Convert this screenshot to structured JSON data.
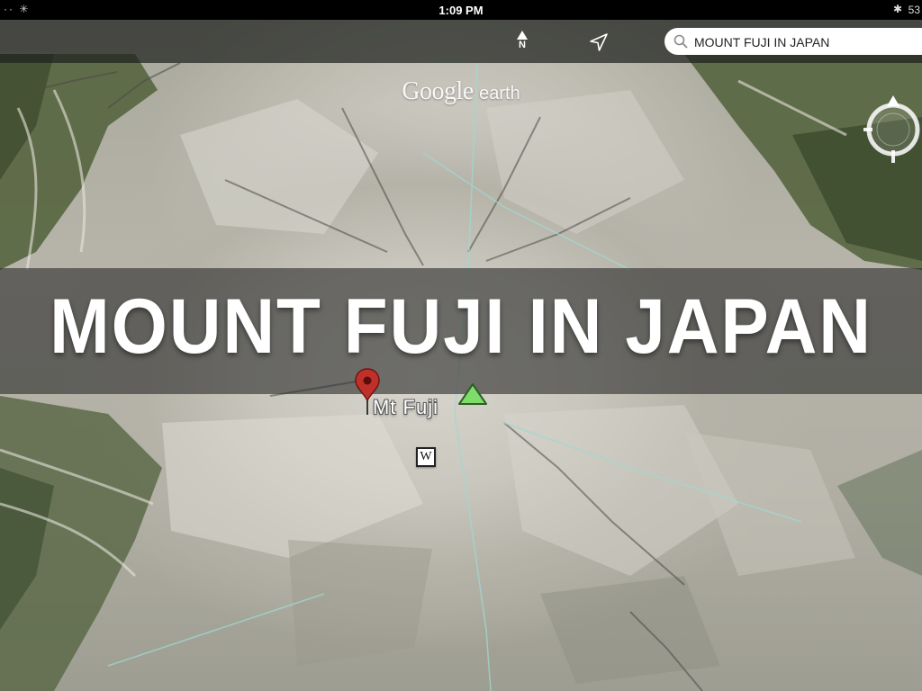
{
  "status_bar": {
    "time": "1:09 PM",
    "battery": "53",
    "left_indicator": "·· ✳",
    "bluetooth_icon": "bluetooth-icon"
  },
  "toolbar": {
    "north_label": "N",
    "search_value": "MOUNT FUJI IN JAPAN",
    "icons": [
      "north-arrow-icon",
      "location-arrow-icon",
      "search-icon"
    ]
  },
  "logo": {
    "google": "Google",
    "earth": "earth"
  },
  "overlay": {
    "title": "MOUNT FUJI IN JAPAN"
  },
  "map": {
    "place_label": "Mt Fuji",
    "wiki_badge": "W",
    "icons": [
      "red-placemark-icon",
      "mountain-peak-icon",
      "wikipedia-icon",
      "compass-icon"
    ],
    "colors": {
      "pin_red": "#c0302a",
      "peak_green": "#7ddc6a",
      "road_cyan": "#9fd8d4",
      "forest_green": "#4a5a38"
    }
  }
}
